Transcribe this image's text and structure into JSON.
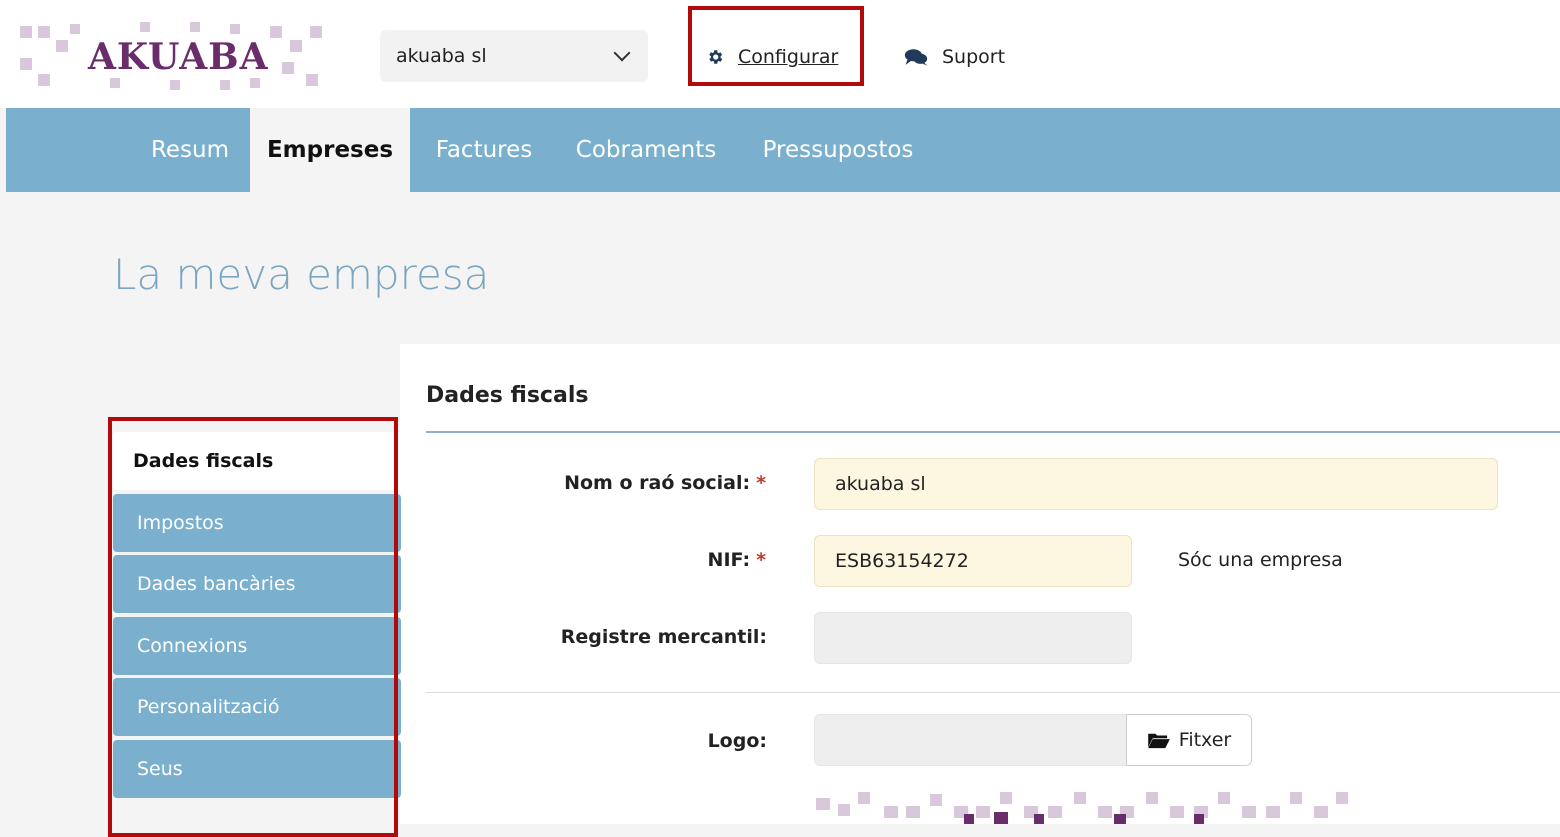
{
  "header": {
    "logo_text": "AKUABA",
    "company_select": {
      "value": "akuaba sl"
    },
    "configure_label": "Configurar",
    "support_label": "Suport"
  },
  "nav": {
    "items": [
      {
        "label": "Resum"
      },
      {
        "label": "Empreses",
        "active": true
      },
      {
        "label": "Factures"
      },
      {
        "label": "Cobraments"
      },
      {
        "label": "Pressupostos"
      }
    ]
  },
  "page": {
    "title": "La meva empresa"
  },
  "sidebar": {
    "items": [
      {
        "label": "Dades fiscals",
        "active": true
      },
      {
        "label": "Impostos"
      },
      {
        "label": "Dades bancàries"
      },
      {
        "label": "Connexions"
      },
      {
        "label": "Personalització"
      },
      {
        "label": "Seus"
      }
    ]
  },
  "form": {
    "section_title": "Dades fiscals",
    "name_label": "Nom o raó social:",
    "name_value": "akuaba sl",
    "nif_label": "NIF:",
    "nif_value": "ESB63154272",
    "nif_note": "Sóc una empresa",
    "registry_label": "Registre mercantil:",
    "registry_value": "",
    "logo_label": "Logo:",
    "file_button_label": "Fitxer",
    "required_marker": "*"
  },
  "colors": {
    "nav_bg": "#7ab0cd",
    "highlight": "#b00a0a",
    "title": "#7aa6c1",
    "brand": "#6a2d6c"
  },
  "icons": {
    "configure": "gear-icon",
    "support": "chat-bubbles-icon",
    "company_dropdown": "chevron-down-icon",
    "file": "folder-open-icon"
  }
}
